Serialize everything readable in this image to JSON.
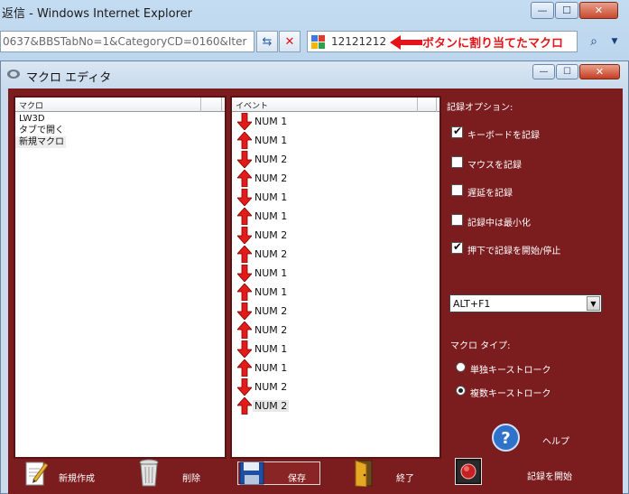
{
  "browser": {
    "title": "返信 - Windows Internet Explorer",
    "window_controls": {
      "minimize": "—",
      "maximize": "☐",
      "close": "✕"
    },
    "address_text": "0637&BBSTabNo=1&CategoryCD=0160&Iter",
    "refresh_glyph": "⇆",
    "stop_glyph": "✕",
    "search_value": "12121212",
    "search_go_glyph": "⌕",
    "search_dropdown_glyph": "▼"
  },
  "annotation": {
    "text": "ボタンに割り当てたマクロ",
    "color": "#e3141a"
  },
  "dialog": {
    "title": "マクロ エディタ",
    "controls": {
      "minimize": "—",
      "maximize": "☐",
      "close": "✕"
    }
  },
  "macro_list": {
    "header": "マクロ",
    "items": [
      "LW3D",
      "タブで開く",
      "新規マクロ"
    ],
    "selected_index": 2
  },
  "event_list": {
    "header": "イベント",
    "events": [
      {
        "dir": "down",
        "label": "NUM 1"
      },
      {
        "dir": "up",
        "label": "NUM 1"
      },
      {
        "dir": "down",
        "label": "NUM 2"
      },
      {
        "dir": "up",
        "label": "NUM 2"
      },
      {
        "dir": "down",
        "label": "NUM 1"
      },
      {
        "dir": "up",
        "label": "NUM 1"
      },
      {
        "dir": "down",
        "label": "NUM 2"
      },
      {
        "dir": "up",
        "label": "NUM 2"
      },
      {
        "dir": "down",
        "label": "NUM 1"
      },
      {
        "dir": "up",
        "label": "NUM 1"
      },
      {
        "dir": "down",
        "label": "NUM 2"
      },
      {
        "dir": "up",
        "label": "NUM 2"
      },
      {
        "dir": "down",
        "label": "NUM 1"
      },
      {
        "dir": "up",
        "label": "NUM 1"
      },
      {
        "dir": "down",
        "label": "NUM 2"
      },
      {
        "dir": "up",
        "label": "NUM 2"
      }
    ],
    "selected_index": 15
  },
  "options": {
    "heading": "記録オプション:",
    "checkboxes": [
      {
        "label": "キーボードを記録",
        "checked": true
      },
      {
        "label": "マウスを記録",
        "checked": false
      },
      {
        "label": "遅延を記録",
        "checked": false
      },
      {
        "label": "記録中は最小化",
        "checked": false
      },
      {
        "label": "押下で記録を開始/停止",
        "checked": true
      }
    ],
    "hotkey": "ALT+F1",
    "hotkey_dropdown_glyph": "▼",
    "macro_type_heading": "マクロ タイプ:",
    "macro_types": [
      {
        "label": "単独キーストローク",
        "selected": false
      },
      {
        "label": "複数キーストローク",
        "selected": true
      }
    ],
    "help_label": "ヘルプ"
  },
  "toolbar": {
    "new_label": "新規作成",
    "delete_label": "削除",
    "save_label": "保存",
    "exit_label": "終了",
    "record_label": "記録を開始"
  },
  "colors": {
    "dialog_body": "#7b1c1e",
    "arrow_red": "#e31b1b"
  }
}
